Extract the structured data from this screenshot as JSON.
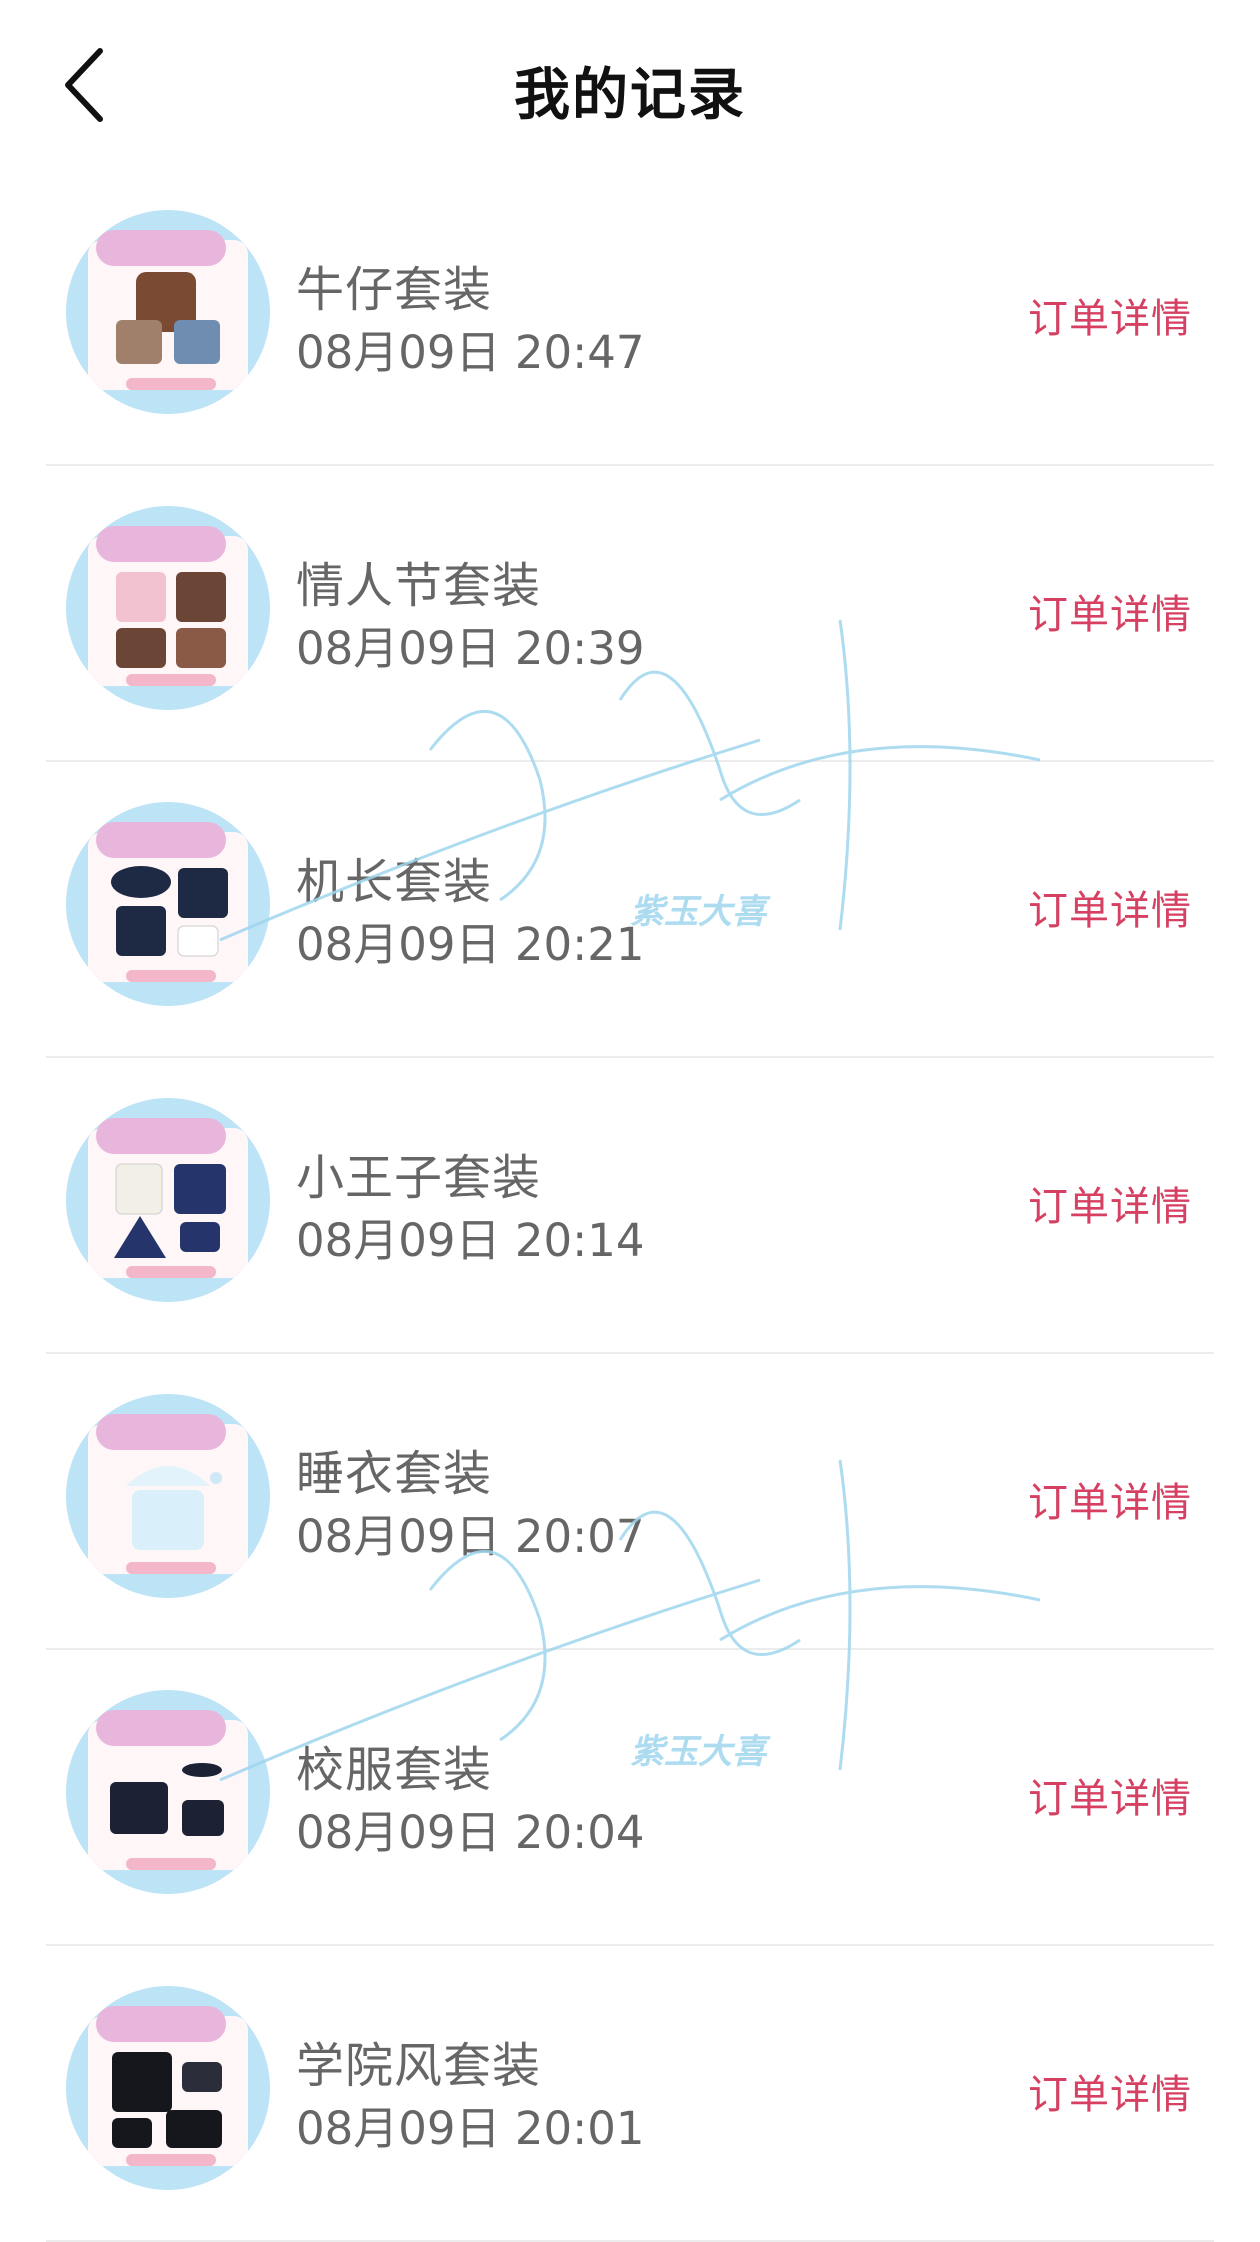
{
  "header": {
    "title": "我的记录"
  },
  "records": [
    {
      "name": "牛仔套装",
      "time": "08月09日 20:47",
      "detail_label": "订单详情"
    },
    {
      "name": "情人节套装",
      "time": "08月09日 20:39",
      "detail_label": "订单详情"
    },
    {
      "name": "机长套装",
      "time": "08月09日 20:21",
      "detail_label": "订单详情"
    },
    {
      "name": "小王子套装",
      "time": "08月09日 20:14",
      "detail_label": "订单详情"
    },
    {
      "name": "睡衣套装",
      "time": "08月09日 20:07",
      "detail_label": "订单详情"
    },
    {
      "name": "校服套装",
      "time": "08月09日 20:04",
      "detail_label": "订单详情"
    },
    {
      "name": "学院风套装",
      "time": "08月09日 20:01",
      "detail_label": "订单详情"
    }
  ],
  "watermark": {
    "text": "紫玉大喜"
  },
  "colors": {
    "accent": "#d64063",
    "text_secondary": "#666666",
    "watermark": "#9fd6ee"
  },
  "icons": {
    "back": "chevron-left-icon"
  }
}
